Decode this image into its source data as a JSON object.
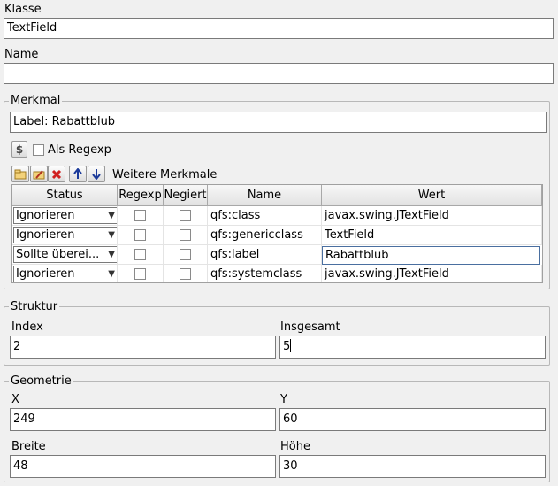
{
  "klasse": {
    "label": "Klasse",
    "value": "TextField"
  },
  "name": {
    "label": "Name",
    "value": ""
  },
  "merkmal": {
    "legend": "Merkmal",
    "value": "Label: Rabattblub",
    "regexp_button_icon": "dollar-icon",
    "regexp_label": "Als Regexp",
    "weitere_label": "Weitere Merkmale",
    "toolbar_icons": [
      "new-icon",
      "edit-icon",
      "delete-icon",
      "move-up-icon",
      "move-down-icon"
    ],
    "table": {
      "headers": [
        "Status",
        "Regexp",
        "Negiert",
        "Name",
        "Wert"
      ],
      "rows": [
        {
          "status": "Ignorieren",
          "name": "qfs:class",
          "wert": "javax.swing.JTextField"
        },
        {
          "status": "Ignorieren",
          "name": "qfs:genericclass",
          "wert": "TextField"
        },
        {
          "status": "Sollte überei...",
          "name": "qfs:label",
          "wert": "Rabattblub"
        },
        {
          "status": "Ignorieren",
          "name": "qfs:systemclass",
          "wert": "javax.swing.JTextField"
        }
      ]
    }
  },
  "struktur": {
    "legend": "Struktur",
    "index": {
      "label": "Index",
      "value": "2"
    },
    "insgesamt": {
      "label": "Insgesamt",
      "value": "5"
    }
  },
  "geometrie": {
    "legend": "Geometrie",
    "x": {
      "label": "X",
      "value": "249"
    },
    "y": {
      "label": "Y",
      "value": "60"
    },
    "breite": {
      "label": "Breite",
      "value": "48"
    },
    "hoehe": {
      "label": "Höhe",
      "value": "30"
    }
  }
}
